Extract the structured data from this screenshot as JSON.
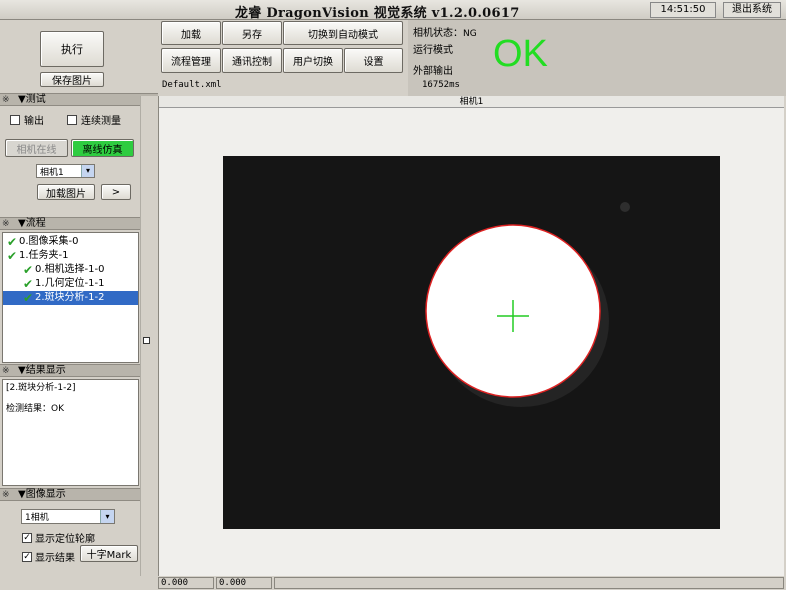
{
  "app": {
    "title": "龙睿 DragonVision 视觉系统 v1.2.0.0617",
    "clock": "14:51:50",
    "exit_label": "退出系统"
  },
  "left": {
    "execute_label": "执行",
    "save_image_label": "保存图片"
  },
  "toolbar": {
    "load_label": "加载",
    "save_as_label": "另存",
    "auto_mode_label": "切换到自动模式",
    "flow_mgmt_label": "流程管理",
    "comm_label": "通讯控制",
    "user_switch_label": "用户切换",
    "settings_label": "设置",
    "filename": "Default.xml",
    "duration": "16752ms"
  },
  "status": {
    "camera_status_label": "相机状态：",
    "camera_status_value": "NG",
    "run_mode_label": "运行模式",
    "ext_output_label": "外部输出",
    "result_big": "OK",
    "result_color": "#22dd22"
  },
  "test_section": {
    "header": "▼测试",
    "output_label": "输出",
    "continuous_label": "连续测量",
    "camera_online_label": "相机在线",
    "offline_sim_label": "离线仿真",
    "camera_select": "相机1",
    "load_image_label": "加载图片",
    "next_label": ">"
  },
  "flow_section": {
    "header": "▼流程",
    "items": [
      {
        "label": "0.图像采集-0",
        "indent": 0,
        "selected": false
      },
      {
        "label": "1.任务夹-1",
        "indent": 0,
        "selected": false
      },
      {
        "label": "0.相机选择-1-0",
        "indent": 1,
        "selected": false
      },
      {
        "label": "1.几何定位-1-1",
        "indent": 1,
        "selected": false
      },
      {
        "label": "2.斑块分析-1-2",
        "indent": 1,
        "selected": true
      }
    ]
  },
  "result_section": {
    "header": "▼结果显示",
    "line1": "[2.斑块分析-1-2]",
    "line2": "检测结果：OK"
  },
  "display_section": {
    "header": "▼图像显示",
    "camera_select": "1相机",
    "show_contour_label": "显示定位轮廓",
    "show_result_label": "显示结果",
    "crosshair_label": "十字Mark"
  },
  "canvas": {
    "tab_label": "相机1"
  },
  "statusbar": {
    "x_value": "0.000",
    "y_value": "0.000"
  }
}
